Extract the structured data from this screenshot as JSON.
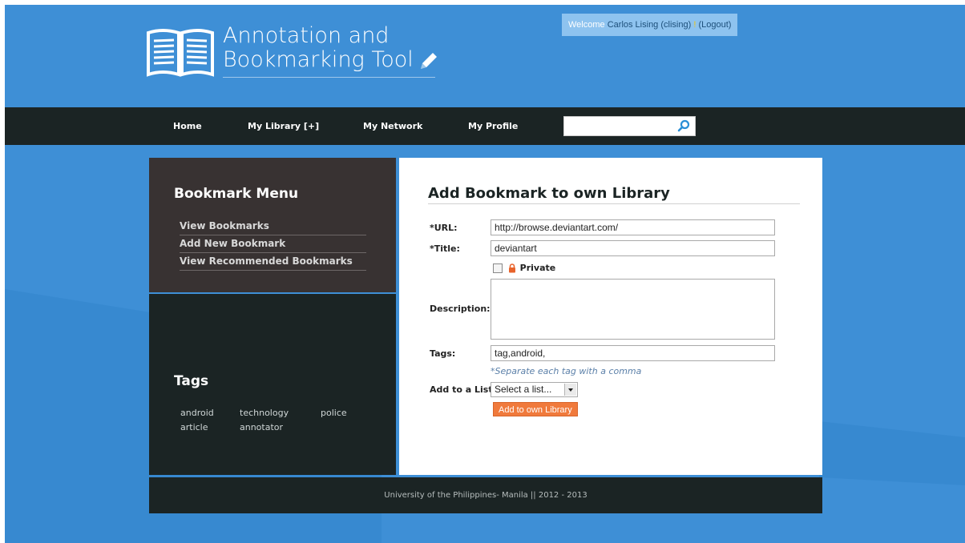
{
  "header": {
    "logo_line1": "Annotation and",
    "logo_line2": "Bookmarking Tool",
    "welcome_prefix": "Welcome",
    "welcome_user": "Carlos Lising (clising)",
    "welcome_bang": "!",
    "logout_label": "(Logout)"
  },
  "nav": {
    "items": [
      {
        "label": "Home"
      },
      {
        "label": "My Library [+]"
      },
      {
        "label": "My Network"
      },
      {
        "label": "My Profile"
      }
    ],
    "search_value": ""
  },
  "sidebar": {
    "menu_title": "Bookmark Menu",
    "menu_items": [
      {
        "label": "View Bookmarks"
      },
      {
        "label": "Add New Bookmark"
      },
      {
        "label": "View Recommended Bookmarks"
      }
    ],
    "tags_title": "Tags",
    "tags": [
      "android",
      "technology",
      "police",
      "article",
      "annotator"
    ]
  },
  "form": {
    "title": "Add Bookmark to own Library",
    "url_label": "*URL:",
    "url_value": "http://browse.deviantart.com/",
    "title_label": "*Title:",
    "title_value": "deviantart",
    "private_label": "Private",
    "description_label": "Description:",
    "tags_label": "Tags:",
    "tags_value": "tag,android,",
    "tags_hint": "*Separate each tag with a comma",
    "list_label": "Add to a List",
    "list_selected": "Select a list...",
    "submit_label": "Add to own Library"
  },
  "footer": {
    "text": "University of the Philippines- Manila || 2012 - 2013"
  },
  "colors": {
    "background": "#3e8fd6",
    "nav_dark": "#1b2424",
    "menu_panel": "#383232",
    "accent_orange": "#f07a3c",
    "search_icon": "#2a8fd6",
    "lock_orange": "#e8632b"
  }
}
